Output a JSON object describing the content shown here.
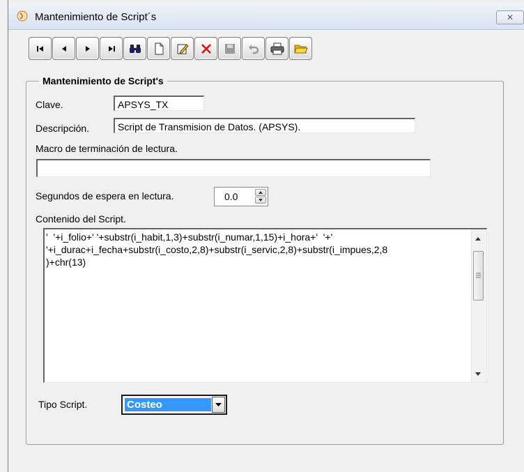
{
  "window": {
    "title": "Mantenimiento de Script´s",
    "close_icon": "close-icon"
  },
  "toolbar": {
    "buttons": [
      {
        "name": "first-record-button",
        "icon": "first-icon",
        "enabled": true
      },
      {
        "name": "previous-record-button",
        "icon": "previous-icon",
        "enabled": true
      },
      {
        "name": "next-record-button",
        "icon": "next-icon",
        "enabled": true
      },
      {
        "name": "last-record-button",
        "icon": "last-icon",
        "enabled": true
      },
      {
        "name": "find-button",
        "icon": "binoculars-icon",
        "enabled": true
      },
      {
        "name": "new-button",
        "icon": "new-document-icon",
        "enabled": true
      },
      {
        "name": "edit-button",
        "icon": "edit-pencil-icon",
        "enabled": true
      },
      {
        "name": "delete-button",
        "icon": "delete-x-icon",
        "enabled": true
      },
      {
        "name": "save-button",
        "icon": "save-icon",
        "enabled": false
      },
      {
        "name": "undo-button",
        "icon": "undo-icon",
        "enabled": false
      },
      {
        "name": "print-button",
        "icon": "printer-icon",
        "enabled": true
      },
      {
        "name": "open-button",
        "icon": "open-folder-icon",
        "enabled": true
      }
    ]
  },
  "form": {
    "group_title": "Mantenimiento de Script's",
    "clave_label": "Clave.",
    "clave_value": "APSYS_TX",
    "descripcion_label": "Descripción.",
    "descripcion_value": "Script de Transmision de Datos. (APSYS).",
    "macro_label": "Macro de terminación de lectura.",
    "macro_value": "",
    "segundos_label": "Segundos de espera en lectura.",
    "segundos_value": "0.0",
    "contenido_label": "Contenido del Script.",
    "contenido_value": "'  '+i_folio+' '+substr(i_habit,1,3)+substr(i_numar,1,15)+i_hora+'  '+'\n'+i_durac+i_fecha+substr(i_costo,2,8)+substr(i_servic,2,8)+substr(i_impues,2,8\n)+chr(13)",
    "tipo_label": "Tipo Script.",
    "tipo_value": "Costeo"
  },
  "colors": {
    "selection": "#3399ff",
    "delete_red": "#e01010",
    "window_bg": "#f0f0f0"
  }
}
